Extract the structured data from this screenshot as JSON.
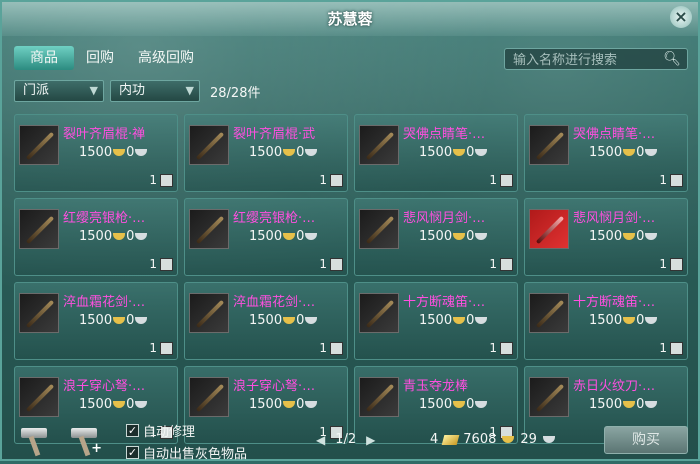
{
  "window": {
    "title": "苏慧蓉",
    "close_label": "×"
  },
  "tabs": [
    {
      "label": "商品",
      "active": true
    },
    {
      "label": "回购",
      "active": false
    },
    {
      "label": "高级回购",
      "active": false
    }
  ],
  "search": {
    "placeholder": "输入名称进行搜索",
    "value": ""
  },
  "filters": {
    "faction": "门派",
    "type": "内功",
    "count": "28/28件"
  },
  "items": [
    {
      "name": "裂叶齐眉棍·禅",
      "price": "1500",
      "silver": "0",
      "qty": "1",
      "icon": "staff-icon"
    },
    {
      "name": "裂叶齐眉棍·武",
      "price": "1500",
      "silver": "0",
      "qty": "1",
      "icon": "staff-icon"
    },
    {
      "name": "哭佛点睛笔·…",
      "price": "1500",
      "silver": "0",
      "qty": "1",
      "icon": "brush-icon"
    },
    {
      "name": "哭佛点睛笔·…",
      "price": "1500",
      "silver": "0",
      "qty": "1",
      "icon": "brush-icon"
    },
    {
      "name": "红缨亮银枪·…",
      "price": "1500",
      "silver": "0",
      "qty": "1",
      "icon": "spear-icon"
    },
    {
      "name": "红缨亮银枪·…",
      "price": "1500",
      "silver": "0",
      "qty": "1",
      "icon": "spear-icon"
    },
    {
      "name": "悲风悯月剑·…",
      "price": "1500",
      "silver": "0",
      "qty": "1",
      "icon": "sword-icon"
    },
    {
      "name": "悲风悯月剑·…",
      "price": "1500",
      "silver": "0",
      "qty": "1",
      "icon": "sword-icon",
      "red": true
    },
    {
      "name": "淬血霜花剑·…",
      "price": "1500",
      "silver": "0",
      "qty": "1",
      "icon": "twin-sword-icon"
    },
    {
      "name": "淬血霜花剑·…",
      "price": "1500",
      "silver": "0",
      "qty": "1",
      "icon": "twin-sword-icon"
    },
    {
      "name": "十方断魂笛·…",
      "price": "1500",
      "silver": "0",
      "qty": "1",
      "icon": "flute-icon"
    },
    {
      "name": "十方断魂笛·…",
      "price": "1500",
      "silver": "0",
      "qty": "1",
      "icon": "flute-icon"
    },
    {
      "name": "浪子穿心弩·…",
      "price": "1500",
      "silver": "0",
      "qty": "1",
      "icon": "crossbow-icon"
    },
    {
      "name": "浪子穿心弩·…",
      "price": "1500",
      "silver": "0",
      "qty": "1",
      "icon": "crossbow-icon"
    },
    {
      "name": "青玉夺龙棒",
      "price": "1500",
      "silver": "0",
      "qty": "1",
      "icon": "jade-rod-icon"
    },
    {
      "name": "赤日火纹刀·…",
      "price": "1500",
      "silver": "0",
      "qty": "1",
      "icon": "blade-icon"
    }
  ],
  "bottom": {
    "auto_repair": "自动修理",
    "auto_sell_gray": "自动出售灰色物品",
    "page": "1/2",
    "gold_prefix": "4",
    "gold": "7608",
    "silver": "29",
    "buy_label": "购买"
  }
}
